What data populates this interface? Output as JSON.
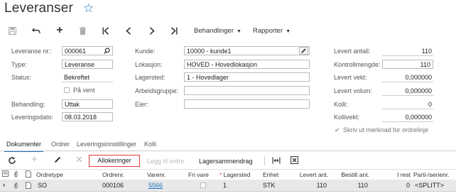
{
  "page": {
    "title": "Leveranser"
  },
  "toolbar": {
    "behandlinger_label": "Behandlinger",
    "rapporter_label": "Rapporter"
  },
  "form": {
    "leveransenr_label": "Leveranse nr.:",
    "leveransenr_value": "000061",
    "type_label": "Type:",
    "type_value": "Leveranse",
    "status_label": "Status:",
    "status_value": "Bekreftet",
    "paa_vent_label": "På vent",
    "behandling_label": "Behandling:",
    "behandling_value": "Uttak",
    "leveringsdato_label": "Leveringsdato:",
    "leveringsdato_value": "08.03.2018",
    "kunde_label": "Kunde:",
    "kunde_value": "10000 - kunde1",
    "lokasjon_label": "Lokasjon:",
    "lokasjon_value": "HOVED - Hovedlokasjon",
    "lagersted_label": "Lagersted:",
    "lagersted_value": "1 - Hovedlager",
    "arbeidsgruppe_label": "Arbeidsgruppe:",
    "arbeidsgruppe_value": "",
    "eier_label": "Eier:",
    "eier_value": "",
    "levert_antall_label": "Levert antall:",
    "levert_antall_value": "110",
    "kontrollmengde_label": "Kontrollmengde:",
    "kontrollmengde_value": "110",
    "levert_vekt_label": "Levert vekt:",
    "levert_vekt_value": "0,000000",
    "levert_volum_label": "Levert volum:",
    "levert_volum_value": "0,000000",
    "kolli_label": "Kolli:",
    "kolli_value": "0",
    "kollivekt_label": "Kollivekt:",
    "kollivekt_value": "0,000000",
    "skriv_ut_label": "Skriv ut merknad for ordrelinje"
  },
  "tabs": [
    {
      "label": "Dokumenter"
    },
    {
      "label": "Ordrer"
    },
    {
      "label": "Leveringsinnstillinger"
    },
    {
      "label": "Kolli"
    }
  ],
  "grid_toolbar": {
    "allokeringer_label": "Allokeringer",
    "legg_til_ordre_label": "Legg til ordre",
    "lagersammendrag_label": "Lagersammendrag"
  },
  "grid": {
    "columns": {
      "ordretype": "Ordretype",
      "ordrenr": "Ordrenr.",
      "varenr": "Varenr.",
      "fri_vare": "Fri vare",
      "lagersted": "Lagersted",
      "enhet": "Enhet",
      "levert_ant": "Levert ant.",
      "bestilt_ant": "Bestilt ant.",
      "i_rest": "I rest",
      "parti_serienr": "Parti-/serienr."
    },
    "rows": [
      {
        "ordretype": "SO",
        "ordrenr": "000106",
        "varenr": "5566",
        "fri_vare": false,
        "lagersted": "1",
        "enhet": "STK",
        "levert_ant": "110",
        "bestilt_ant": "110",
        "i_rest": "0",
        "parti_serienr": "<SPLITT>"
      }
    ]
  },
  "colors": {
    "accent": "#1e73be",
    "highlight_border": "#e53935",
    "row_selected": "#e8e8e8"
  }
}
